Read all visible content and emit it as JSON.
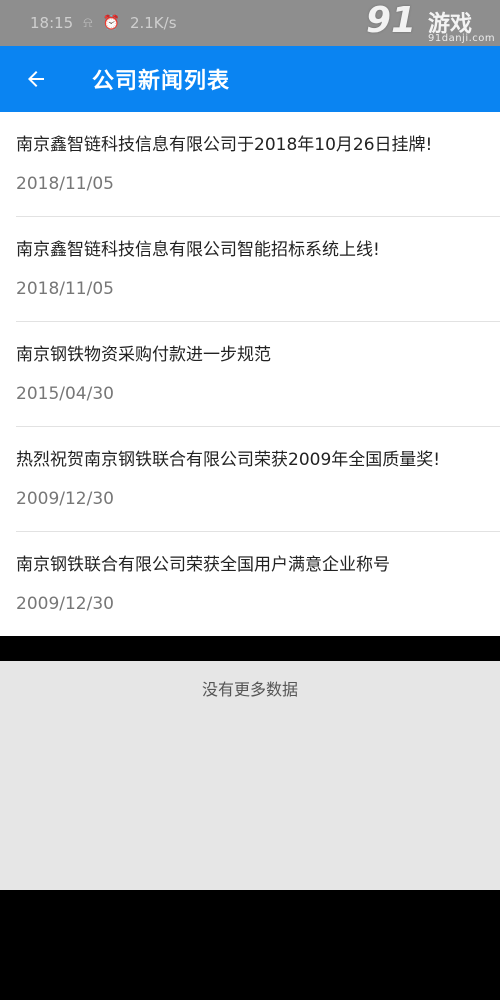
{
  "status_bar": {
    "time": "18:15",
    "speed": "2.1K/s",
    "icons": [
      "vibrate-icon",
      "alarm-icon"
    ]
  },
  "watermark": {
    "number": "91",
    "brand": "游戏",
    "url": "91danji.com"
  },
  "header": {
    "back_icon": "arrow-left-icon",
    "title": "公司新闻列表",
    "color": "#0a84f2"
  },
  "news": [
    {
      "title": "南京鑫智链科技信息有限公司于2018年10月26日挂牌!",
      "date": "2018/11/05"
    },
    {
      "title": "南京鑫智链科技信息有限公司智能招标系统上线!",
      "date": "2018/11/05"
    },
    {
      "title": "南京钢铁物资采购付款进一步规范",
      "date": "2015/04/30"
    },
    {
      "title": "热烈祝贺南京钢铁联合有限公司荣获2009年全国质量奖!",
      "date": "2009/12/30"
    },
    {
      "title": "南京钢铁联合有限公司荣获全国用户满意企业称号",
      "date": "2009/12/30"
    }
  ],
  "footer": {
    "no_more_text": "没有更多数据"
  }
}
